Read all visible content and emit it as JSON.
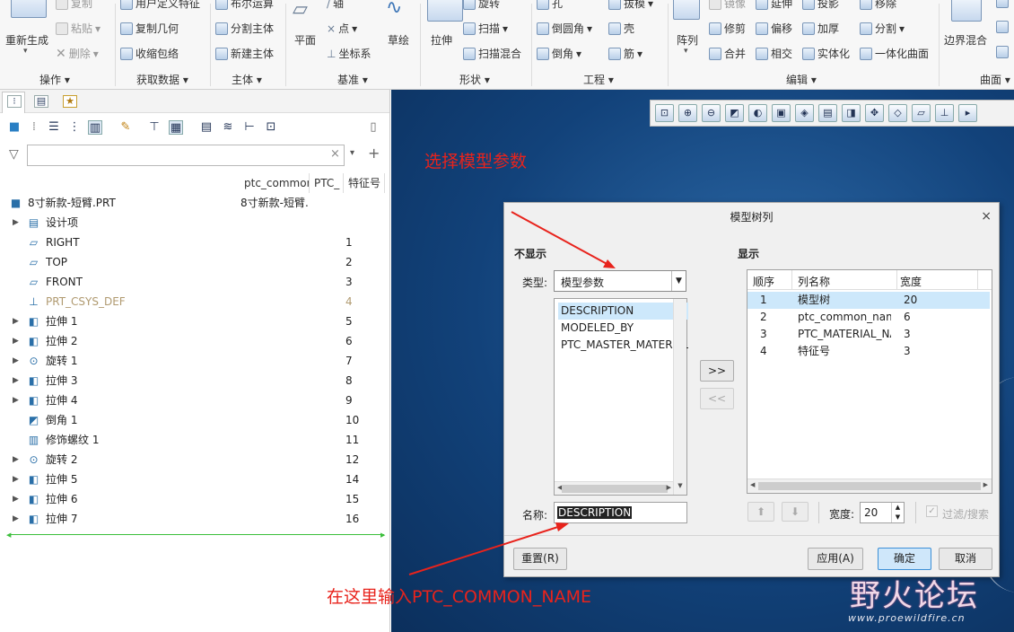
{
  "ribbon": {
    "regen": {
      "label": "重新生成"
    },
    "ops": [
      {
        "label": "复制",
        "disabled": true
      },
      {
        "label": "粘贴",
        "disabled": true
      },
      {
        "label": "删除",
        "disabled": true
      }
    ],
    "getdata": [
      {
        "label": "用户定义特征"
      },
      {
        "label": "复制几何"
      },
      {
        "label": "收缩包络"
      }
    ],
    "body": [
      {
        "label": "布尔运算"
      },
      {
        "label": "分割主体"
      },
      {
        "label": "新建主体"
      }
    ],
    "datum": [
      {
        "label": "平面"
      },
      {
        "label": "轴"
      },
      {
        "label": "点"
      },
      {
        "label": "坐标系"
      },
      {
        "label": "草绘"
      }
    ],
    "shape": [
      {
        "label": "拉伸"
      },
      {
        "label": "旋转"
      },
      {
        "label": "扫描"
      },
      {
        "label": "扫描混合"
      }
    ],
    "eng": [
      {
        "label": "孔"
      },
      {
        "label": "倒圆角"
      },
      {
        "label": "倒角"
      },
      {
        "label": "拔模"
      },
      {
        "label": "壳"
      },
      {
        "label": "筋"
      }
    ],
    "edit": [
      {
        "label": "阵列"
      },
      {
        "label": "镜像"
      },
      {
        "label": "延伸"
      },
      {
        "label": "投影"
      },
      {
        "label": "修剪"
      },
      {
        "label": "偏移"
      },
      {
        "label": "加厚"
      },
      {
        "label": "合并"
      },
      {
        "label": "相交"
      },
      {
        "label": "实体化"
      },
      {
        "label": "移除"
      },
      {
        "label": "分割"
      },
      {
        "label": "一体化曲面"
      }
    ],
    "surf": [
      {
        "label": "边界混合"
      }
    ],
    "groups": {
      "ops": "操作",
      "getdata": "获取数据",
      "body": "主体",
      "datum": "基准",
      "shape": "形状",
      "eng": "工程",
      "edit": "编辑",
      "surf": "曲面"
    }
  },
  "tree": {
    "filter_placeholder": "",
    "columns": [
      "ptc_common",
      "PTC_",
      "特征号"
    ],
    "root": {
      "label": "8寸新款-短臂.PRT",
      "col1": "8寸新款-短臂."
    },
    "rows": [
      {
        "label": "设计项",
        "num": "",
        "expand": true,
        "icon": "folder-icon"
      },
      {
        "label": "RIGHT",
        "num": "1",
        "expand": false,
        "icon": "datum-plane-icon"
      },
      {
        "label": "TOP",
        "num": "2",
        "expand": false,
        "icon": "datum-plane-icon"
      },
      {
        "label": "FRONT",
        "num": "3",
        "expand": false,
        "icon": "datum-plane-icon"
      },
      {
        "label": "PRT_CSYS_DEF",
        "num": "4",
        "expand": false,
        "icon": "csys-icon",
        "dim": true
      },
      {
        "label": "拉伸 1",
        "num": "5",
        "expand": true,
        "icon": "extrude-icon"
      },
      {
        "label": "拉伸 2",
        "num": "6",
        "expand": true,
        "icon": "extrude-icon"
      },
      {
        "label": "旋转 1",
        "num": "7",
        "expand": true,
        "icon": "revolve-icon"
      },
      {
        "label": "拉伸 3",
        "num": "8",
        "expand": true,
        "icon": "extrude-icon"
      },
      {
        "label": "拉伸 4",
        "num": "9",
        "expand": true,
        "icon": "extrude-icon"
      },
      {
        "label": "倒角 1",
        "num": "10",
        "expand": false,
        "icon": "chamfer-icon"
      },
      {
        "label": "修饰螺纹 1",
        "num": "11",
        "expand": false,
        "icon": "thread-icon"
      },
      {
        "label": "旋转 2",
        "num": "12",
        "expand": true,
        "icon": "revolve-icon"
      },
      {
        "label": "拉伸 5",
        "num": "14",
        "expand": true,
        "icon": "extrude-icon"
      },
      {
        "label": "拉伸 6",
        "num": "15",
        "expand": true,
        "icon": "extrude-icon"
      },
      {
        "label": "拉伸 7",
        "num": "16",
        "expand": true,
        "icon": "extrude-icon"
      }
    ]
  },
  "dialog": {
    "title": "模型树列",
    "not_shown": "不显示",
    "shown": "显示",
    "type_label": "类型:",
    "type_value": "模型参数",
    "params": [
      {
        "label": "DESCRIPTION",
        "selected": true
      },
      {
        "label": "MODELED_BY",
        "selected": false
      },
      {
        "label": "PTC_MASTER_MATERIAL",
        "selected": false
      }
    ],
    "add": ">>",
    "remove": "<<",
    "name_label": "名称:",
    "name_value": "DESCRIPTION",
    "table_headers": [
      "顺序",
      "列名称",
      "宽度"
    ],
    "table_rows": [
      {
        "order": "1",
        "name": "模型树",
        "width": "20",
        "selected": true
      },
      {
        "order": "2",
        "name": "ptc_common_nam",
        "width": "6",
        "selected": false
      },
      {
        "order": "3",
        "name": "PTC_MATERIAL_NA",
        "width": "3",
        "selected": false
      },
      {
        "order": "4",
        "name": "特征号",
        "width": "3",
        "selected": false
      }
    ],
    "width_label": "宽度:",
    "width_value": "20",
    "filter_label": "过滤/搜索",
    "reset": "重置(R)",
    "apply": "应用(A)",
    "ok": "确定",
    "cancel": "取消"
  },
  "annotations": {
    "top": "选择模型参数",
    "bottom": "在这里输入PTC_COMMON_NAME"
  },
  "watermark": {
    "title": "野火论坛",
    "url": "www.proewildfire.cn"
  }
}
